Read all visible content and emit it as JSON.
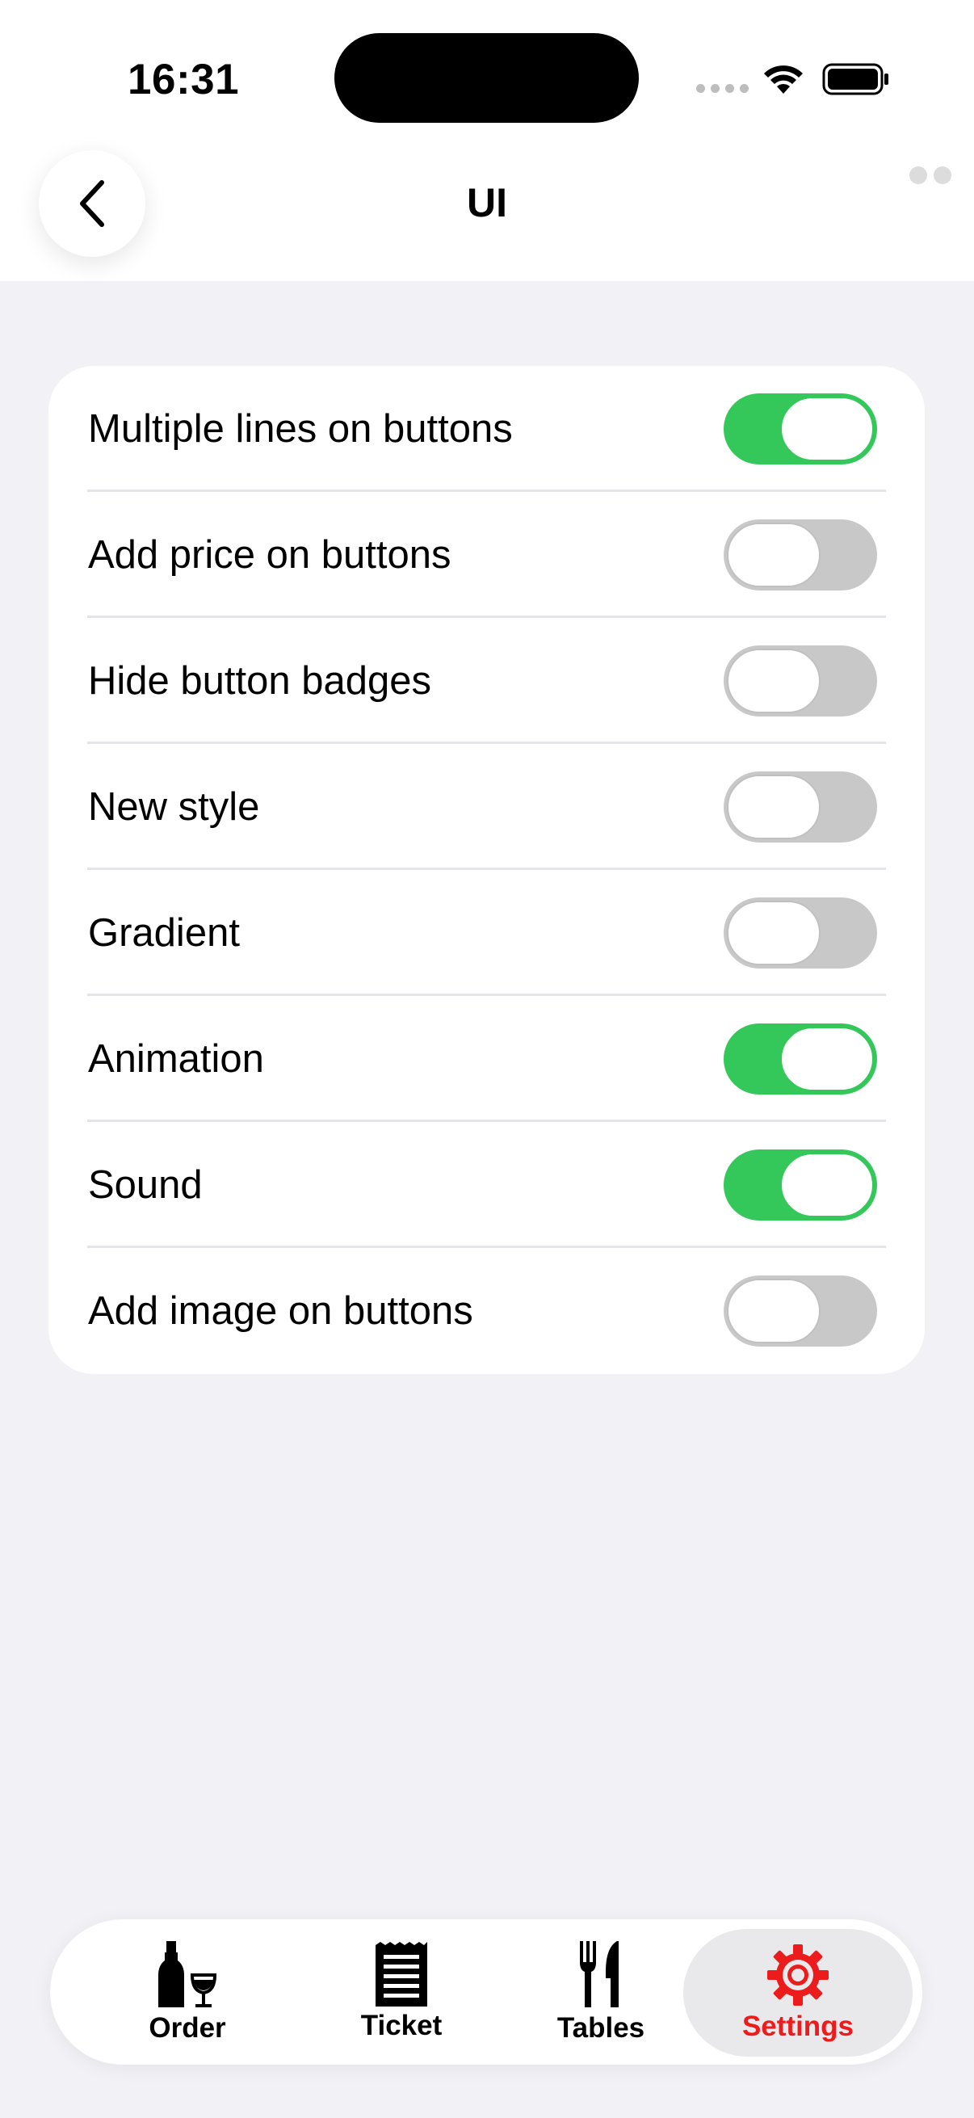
{
  "status_bar": {
    "time": "16:31"
  },
  "nav": {
    "title": "UI"
  },
  "settings": [
    {
      "label": "Multiple lines on buttons",
      "on": true
    },
    {
      "label": "Add price on buttons",
      "on": false
    },
    {
      "label": "Hide button badges",
      "on": false
    },
    {
      "label": "New style",
      "on": false
    },
    {
      "label": "Gradient",
      "on": false
    },
    {
      "label": "Animation",
      "on": true
    },
    {
      "label": "Sound",
      "on": true
    },
    {
      "label": "Add image on buttons",
      "on": false
    }
  ],
  "tabs": [
    {
      "label": "Order",
      "icon": "bottle-glass-icon"
    },
    {
      "label": "Ticket",
      "icon": "receipt-icon"
    },
    {
      "label": "Tables",
      "icon": "fork-knife-icon"
    },
    {
      "label": "Settings",
      "icon": "gear-icon",
      "active": true
    }
  ],
  "colors": {
    "accent_on": "#34c759",
    "active_tab": "#ec1c1c",
    "background": "#f1f1f6"
  }
}
